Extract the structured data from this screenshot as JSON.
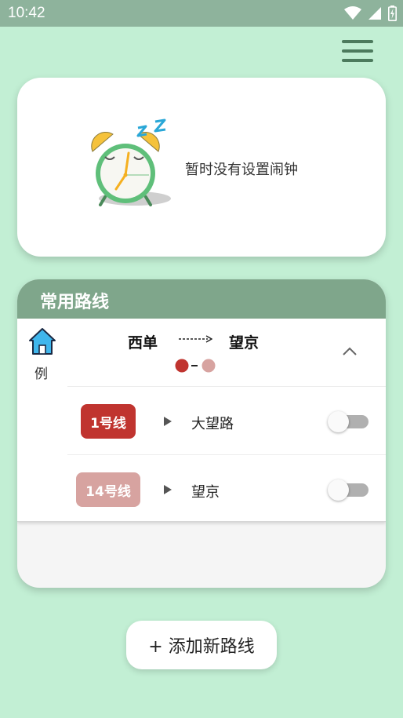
{
  "status_bar": {
    "time": "10:42"
  },
  "alarm": {
    "empty_text": "暂时没有设置闹钟"
  },
  "routes": {
    "title": "常用路线",
    "example_label": "例",
    "from": "西单",
    "to": "望京",
    "dot_colors": [
      "#c0342f",
      "#d7a3a0"
    ],
    "lines": [
      {
        "badge": "1号线",
        "color": "#c0342f",
        "station": "大望路",
        "enabled": false
      },
      {
        "badge": "14号线",
        "color": "#d7a3a0",
        "station": "望京",
        "enabled": false
      }
    ]
  },
  "add_route_button": "+ 添加新路线"
}
